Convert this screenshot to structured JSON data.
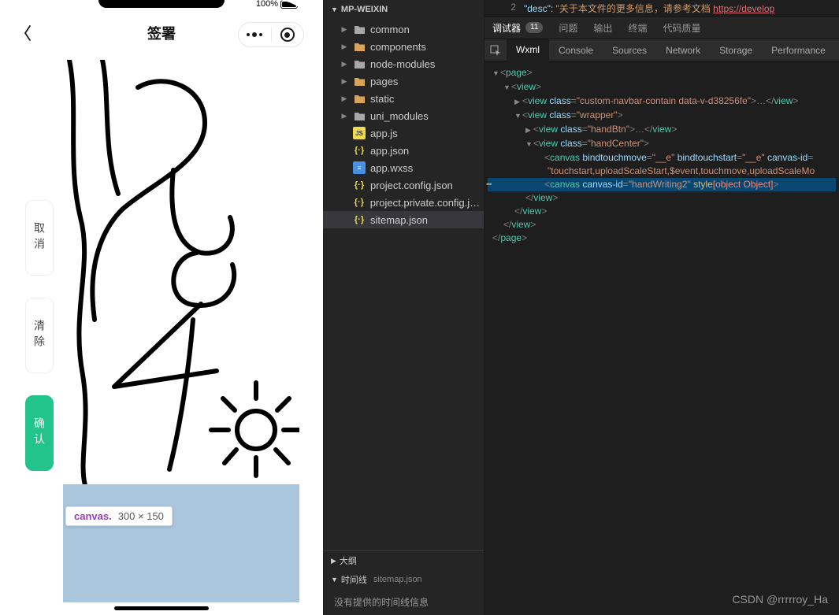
{
  "simulator": {
    "statusbar": {
      "battery_text": "100%"
    },
    "nav": {
      "title": "签署"
    },
    "buttons": {
      "cancel": "取消",
      "clear": "清除",
      "confirm": "确认"
    },
    "inspect_tip": {
      "tag": "canvas.",
      "dim": "300 × 150"
    }
  },
  "explorer": {
    "project": "MP-WEIXIN",
    "tree": [
      {
        "type": "folder",
        "label": "common",
        "open": false
      },
      {
        "type": "folder",
        "label": "components",
        "open": false,
        "iconOpen": true
      },
      {
        "type": "folder",
        "label": "node-modules",
        "open": false
      },
      {
        "type": "folder",
        "label": "pages",
        "open": false,
        "iconOpen": true
      },
      {
        "type": "folder",
        "label": "static",
        "open": false,
        "iconOpen": true
      },
      {
        "type": "folder",
        "label": "uni_modules",
        "open": false
      },
      {
        "type": "file",
        "label": "app.js",
        "icon": "js"
      },
      {
        "type": "file",
        "label": "app.json",
        "icon": "json"
      },
      {
        "type": "file",
        "label": "app.wxss",
        "icon": "wxss"
      },
      {
        "type": "file",
        "label": "project.config.json",
        "icon": "json"
      },
      {
        "type": "file",
        "label": "project.private.config.js…",
        "icon": "json"
      },
      {
        "type": "file",
        "label": "sitemap.json",
        "icon": "json",
        "selected": true
      }
    ],
    "outline_label": "大纲",
    "timeline_label": "时间线",
    "timeline_file": "sitemap.json",
    "timeline_empty": "没有提供的时间线信息"
  },
  "devtools": {
    "code_preview": {
      "line": "2",
      "key": "\"desc\"",
      "colon": ":",
      "value_prefix": "\"关于本文件的更多信息，请参考文档 ",
      "link": "https://develop"
    },
    "dbg_tabs": {
      "debugger": "调试器",
      "badge": "11",
      "problems": "问题",
      "output": "输出",
      "terminal": "终端",
      "quality": "代码质量"
    },
    "tool_tabs": {
      "wxml": "Wxml",
      "console": "Console",
      "sources": "Sources",
      "network": "Network",
      "storage": "Storage",
      "performance": "Performance"
    },
    "dom": {
      "l0": "<page>",
      "l1": "<view>",
      "l2_open": "<view",
      "l2_attr_class": "class=",
      "l2_val_class": "\"custom-navbar-contain data-v-d38256fe\"",
      "l2_close": ">…</view>",
      "l3_open": "<view",
      "l3_attr": "class=",
      "l3_val": "\"wrapper\"",
      "l3_close": ">",
      "l4_open": "<view",
      "l4_attr": "class=",
      "l4_val": "\"handBtn\"",
      "l4_close": ">…</view>",
      "l5_open": "<view",
      "l5_attr": "class=",
      "l5_val": "\"handCenter\"",
      "l5_close": ">",
      "l6_open": "<canvas",
      "l6_a1": "bindtouchmove=",
      "l6_v1": "\"__e\"",
      "l6_a2": "bindtouchstart=",
      "l6_v2": "\"__e\"",
      "l6_a3": "canvas-id=",
      "l7": "\"touchstart,uploadScaleStart,$event,touchmove,uploadScaleMo",
      "l8_open": "<canvas",
      "l8_a1": "canvas-id=",
      "l8_v1": "\"handWriting2\"",
      "l8_a2": "style",
      "l8_v2": "[object Object]",
      "l8_close": ">",
      "c_view": "</view>",
      "c_page": "</page>"
    }
  },
  "watermark": "CSDN @rrrrroy_Ha"
}
